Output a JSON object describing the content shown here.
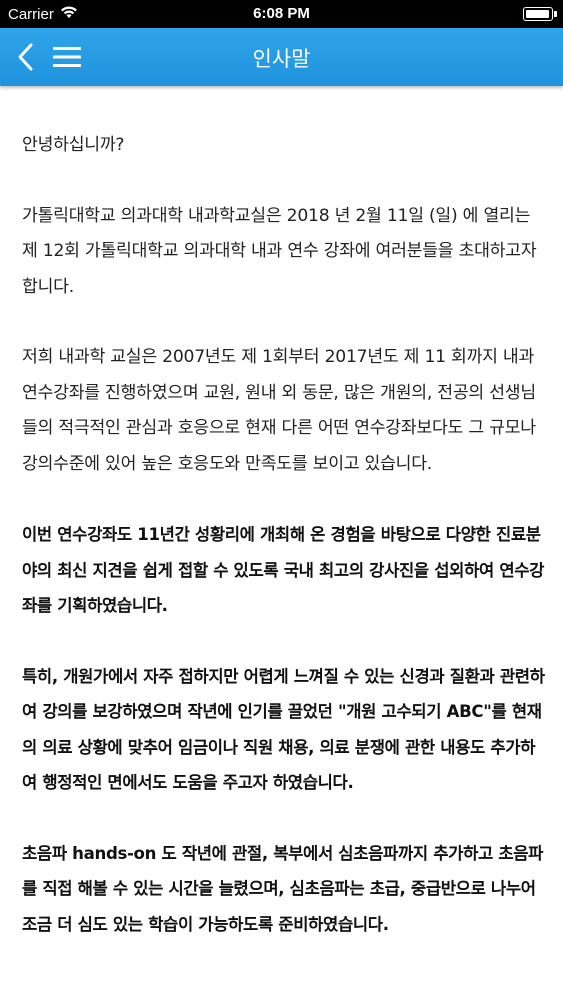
{
  "status_bar": {
    "carrier": "Carrier",
    "time": "6:08 PM",
    "battery_level": 1.0,
    "wifi_icon": "wifi-icon",
    "battery_icon": "battery-icon"
  },
  "nav": {
    "title": "인사말",
    "back_icon": "chevron-left-icon",
    "menu_icon": "hamburger-menu-icon",
    "bar_color": "#2a9fe6"
  },
  "content": {
    "greeting": "안녕하십니까?",
    "p1": "가톨릭대학교 의과대학 내과학교실은 2018 년 2월 11일 (일) 에 열리는 제 12회 가톨릭대학교 의과대학 내과 연수 강좌에 여러분들을 초대하고자 합니다.",
    "p2": "저희 내과학 교실은 2007년도 제 1회부터 2017년도 제 11 회까지 내과 연수강좌를 진행하였으며 교원, 원내 외 동문, 많은 개원의, 전공의 선생님들의 적극적인 관심과 호응으로 현재 다른 어떤 연수강좌보다도 그 규모나 강의수준에 있어 높은 호응도와 만족도를 보이고 있습니다.",
    "p3": "이번 연수강좌도 11년간 성황리에 개최해 온 경험을 바탕으로 다양한 진료분야의 최신 지견을 쉽게 접할 수 있도록 국내 최고의 강사진을 섭외하여 연수강좌를 기획하였습니다.",
    "p4": "특히, 개원가에서 자주 접하지만 어렵게 느껴질 수 있는 신경과 질환과 관련하여 강의를 보강하였으며 작년에 인기를 끌었던 \"개원 고수되기 ABC\"를 현재의 의료 상황에 맞추어 임금이나 직원 채용, 의료 분쟁에 관한 내용도 추가하여 행정적인 면에서도 도움을 주고자 하였습니다.",
    "p5": "초음파 hands-on 도 작년에 관절, 복부에서 심초음파까지 추가하고 초음파를 직접 해볼 수 있는 시간을 늘렸으며, 심초음파는 초급, 중급반으로 나누어 조금 더 심도 있는 학습이 가능하도록 준비하였습니다."
  }
}
